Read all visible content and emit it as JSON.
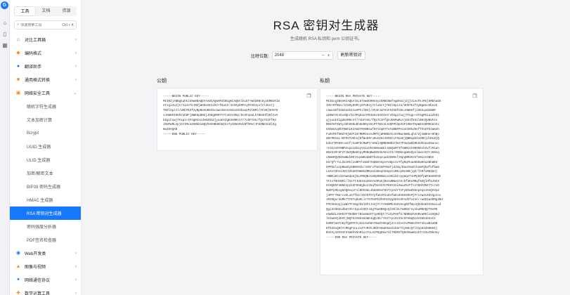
{
  "rail": {
    "logo": "G"
  },
  "sidebar": {
    "tabs": [
      "工具",
      "文档",
      "资源"
    ],
    "search_placeholder": "快速搜索工具",
    "search_kbd": "Ctrl + K",
    "groups_top": [
      {
        "label": "对比工具箱",
        "icon": "⌂",
        "color": "#1677ff"
      },
      {
        "label": "编码格式",
        "icon": "◆",
        "color": "#fa8c16"
      },
      {
        "label": "翻译助手",
        "icon": "●",
        "color": "#1677ff"
      },
      {
        "label": "通用格式转换",
        "icon": "■",
        "color": "#fa8c16"
      }
    ],
    "security_group": {
      "label": "网络安全工具",
      "icon": "▣",
      "color": "#fa8c16"
    },
    "sub_items": [
      "随机字符生成器",
      "文本加密计算",
      "Bcrypt",
      "UUID 生成器",
      "ULID 生成器",
      "加密/解密文本",
      "BIP39 密码生成器",
      "HMAC 生成器",
      "RSA 密钥对生成器",
      "密码强度分析器",
      "PDF签名检查器"
    ],
    "active_sub_index": 8,
    "groups_bottom": [
      {
        "label": "Web开发类",
        "icon": "◉",
        "color": "#1677ff"
      },
      {
        "label": "图像与视频",
        "icon": "▲",
        "color": "#fa8c16"
      },
      {
        "label": "网络通信协议",
        "icon": "✦",
        "color": "#1677ff"
      },
      {
        "label": "数学运算工具",
        "icon": "✚",
        "color": "#fa8c16"
      }
    ]
  },
  "main": {
    "title": "RSA 密钥对生成器",
    "subtitle": "生成随机 RSA 私钥和 pem 公钥证书。",
    "bits_label": "比特位数:",
    "bits_value": "2048",
    "regen_label": "刷新密钥对",
    "public_label": "公钥",
    "private_label": "私钥",
    "public_key": "-----BEGIN PUBLIC KEY-----\nMIIBIjANBgkqhkiG9w0BAQEFAAOCAQ8AMIIBCgKCAQEAlkLET+W4GR0nSyzERBINlm\neTxgi4v2jI/ViAoTkJMZjmDDaAKIzHV+f8uCZ/3zSOyDOPcyOYV0Jyx7zl45stj\nTKDl5pJJl/UHbTEZf2yBpNeeUB5IbcSwcm5sXx03uS5IEaApP3lBMJ/AFa9jSHsF6\nvJAWH0IHHhVuhDFj8WE6p8NXjJD0gDR6YYYtxKtnONv/DcXFqSaLh7B83HfZ0lIvV\nkbgLCnwjTFapx+4FSgR4xIdA0ZRIZjyuaEIZgE6ARRcV7/7obFYeG/fQs7CIFf9X\nJDUPwRLVpjGYIMxeZSMkEnmQVhHVHBHKh8Ikn7ySbNoMxkBfhMvtJFKZNEIUdlZg\nKwIDAQAB\n-----END PUBLIC KEY-----",
    "private_key": "-----BEGIN RSA PRIVATE KEY-----\nMIIEogIBAAKCAQEAlkLETnW4GR0nSyzERBINmfegEHa1jdjjViAoTkJMCjmMDAaGK\nIHV+RfBUs/3zS0yDOPcyOYV0Jy7zlu5ctjTKDl5pzJ3/UHbTEzf2yBgmnoSbnxE\ncSwcm5fXdU3uS5IzaAPFJlBVj/AFaFJaFHxF6IbOfU9vJAWHUfjiHEkqxN2WHR\nqk8WYVCsExdQn/DcXPqSaLH7B3kHv2H3VeIrvkbgLCnqjTFagc+4FSgRCiaiZkK1\nqjyuuEI1gd6ARRcV7/7obFYeG/fQsTCIFfQXJDUPwRLVjGEIfE51lB6tQVBVktn\nREKFHTXW7yJEh9S0uDh5H5RyS5LPT7B2cKJvBFMtOpXSFtOBATVpW5V2DM9GHJXx\nGhhmUCqKhTRmhLKIAUZYMANR4afHYoIqEYTnFaBNFPe1nCkRkdHnfThVUTUzwm3h\nFu0zMIf6Nd7HjWVFiHrMBMIexndMFhjWH0BGACz6YBwn6WULqh4/UjnW8Hn+HhBo\nd0rM6VaL+KF01TUShnjDfWoE0ru0uVZ6sIKO6tLFGUu6jQBBxpEXxOODjdlRLBjQ\nbdnITRY69+uoCf+ka9FbCMwPTr8AWl3QMDHKBbkTmz7P4aCwKbRk5dhUaxE8unxc\n+tnbJu9YNBhVxpa1ZG1yV4iLDkkm0ewm8JJ4mQaM7IfAWBC4I9N95Dcb4vfzRiwn\nHDs51MrKF2TJWzQNm8tpyM5RqBwOZK3kA5eJtS/VNSKngmKeZpnlUwxsH7rJU8Aq\ncNmeRQVE0AwNUiRK7AqvWKUdmETb2UqxcwdJ09RvlY5pqNM4KtkfnN1oV4BOe\nkD/Qfr7cLO2cRkl1vBPrhzW3hYUKBVASpvFsBpLVvTfqRqFkaU85Ew0Xa4NhmB3\nkPPbUlxzpMwxEyD0BV9zb/3zRrvfOeI5PYKaTjdJOq/BaUz9a0lh2mFQhZfUfDw6\nLGAvYOhCdJ8tIZbkKFNm0XZMKeaI3DeqhGHqVz1RKcp0LNHkjqZ/lhRfuMHXGHj\n+NBKiBtL8zAw6dpmjGLVMUQBJcmOp9NSWxvsH5iD2+pyWqeTsHPp50fpWYmSeNFGk\nYFJxTOHtBRl/lhe7TJUG1XqnNAYeOPaGjBeAUBWuCt8+bf3KLMRqf0ZQlHfmJ9ZX\n6tHQNhFnBNOJpykXF95Dgbuz35qfNsXCXtPb0Y2eiXwuZ6zFfsxYDHFZNI7TcJJO\nNU0TpOkxg6AQ9oqcF1lDDh3UL4bm49GsF8VTrpA2YTzFyBVwZ5bepXqXJXeQVVpZ\nj4PFr7KErcvKLuS7fk2/XXt9ThYyfaEAP2x8nfwDJ4h0U2RcMjFrvJw4LK5Yqpzoo\nJ0V9Qa/XUMk7TY6Tq9a9LlcT97D4PhZh6FE32ghEhtHFAdhfuI3A/+wZ81w2DMg3Nd\nFPCkK0JpjiaWY7FA8gzb5lDhtJsGjFcTrH89Mk3SZv5sg0ZfWvcQkHbaKIXXGaiud\nQgi3zOOUxdkmtXhrIq1vk5Dts6gTGwXB5QcQlH9lXLTm8N2rnyvkwMKHQ2T0vM9\ne5WbZLzGHOJFTRdDBrtN3u8m2FF1p9EQT/TiXyPvKfk/NDB5ZAVnBvwR8lx2XQHd\nl6Jw9Hj2EHtjNQTE2V8kXU3mE4qQc5E/YkG7+pc6z2hnIPeNqDc2vXm51bXxC1\nb5R0TaH7nKyfQpMYFkJ3eL6uD8nY0aZtB5qWj4rc1GvV2xP9mHJ9eT3kLwN1a0B\nKfD3XvQ8tYcR5gP1nL2sZ7oM4hJ0bFe6wK9aU3iE8rT2yN5cQ7lV1pH4dS0mG6j\nB4sXy3Zk9oF2tW8hV5nR1aJ7eL3cP0gK6uY4iT8bM2fQ9dS5wN1xE7rZ3vC0kH4y\n-----END RSA PRIVATE KEY-----"
  }
}
